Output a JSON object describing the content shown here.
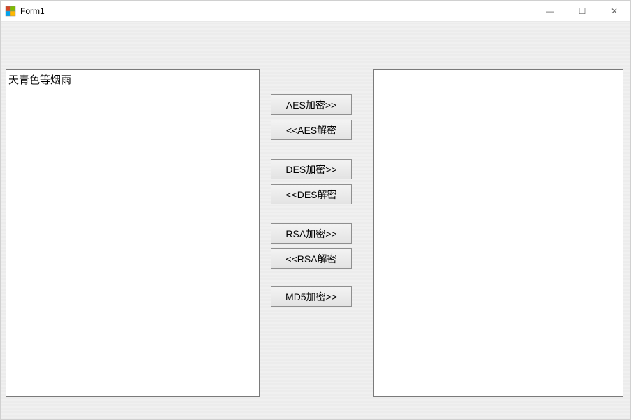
{
  "window": {
    "title": "Form1"
  },
  "input": {
    "left_text": "天青色等烟雨",
    "right_text": ""
  },
  "buttons": {
    "aes_encrypt": "AES加密>>",
    "aes_decrypt": "<<AES解密",
    "des_encrypt": "DES加密>>",
    "des_decrypt": "<<DES解密",
    "rsa_encrypt": "RSA加密>>",
    "rsa_decrypt": "<<RSA解密",
    "md5_encrypt": "MD5加密>>"
  },
  "window_controls": {
    "minimize": "—",
    "maximize": "☐",
    "close": "✕"
  }
}
